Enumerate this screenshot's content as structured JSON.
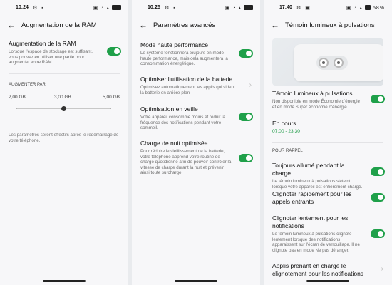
{
  "screen1": {
    "status": {
      "time": "10:24",
      "battery": ""
    },
    "title": "Augmentation de la RAM",
    "ram": {
      "title": "Augmentation de la RAM",
      "desc": "Lorsque l'espace de stockage est suffisant, vous pouvez en utiliser une partie pour augmenter votre RAM.",
      "enabled": true
    },
    "section": "AUGMENTER PAR",
    "slider": {
      "options": [
        "2,00 GB",
        "3,00 GB",
        "5,00 GB"
      ],
      "selected": "3,00 GB"
    },
    "note": "Les paramètres seront effectifs après le redémarrage de votre téléphone."
  },
  "screen2": {
    "status": {
      "time": "10:25"
    },
    "title": "Paramètres avancés",
    "items": [
      {
        "title": "Mode haute performance",
        "desc": "Le système fonctionnera toujours en mode haute performance, mais cela augmentera la consommation énergétique.",
        "control": "toggle",
        "enabled": true
      },
      {
        "title": "Optimiser l'utilisation de la batterie",
        "desc": "Optimisez automatiquement les applis qui vident la batterie en arrière-plan",
        "control": "chevron"
      },
      {
        "title": "Optimisation en veille",
        "desc": "Votre appareil consomme moins et réduit la fréquence des notifications pendant votre sommeil.",
        "control": "toggle",
        "enabled": true
      },
      {
        "title": "Charge de nuit optimisée",
        "desc": "Pour réduire le vieillissement de la batterie, votre téléphone apprend votre routine de charge quotidienne afin de pouvoir contrôler la vitesse de charge durant la nuit et prévenir ainsi toute surcharge.",
        "control": "toggle",
        "enabled": true
      }
    ]
  },
  "screen3": {
    "status": {
      "time": "17:40",
      "battery": "58%"
    },
    "title": "Témoin lumineux à pulsations",
    "main": {
      "title": "Témoin lumineux à pulsations",
      "desc": "Non disponible en mode Économie d'énergie et en mode Super économie d'énergie",
      "enabled": true
    },
    "schedule": {
      "title": "En cours",
      "value": "07:00 - 23:30"
    },
    "section": "POUR RAPPEL",
    "items": [
      {
        "title": "Toujours allumé pendant la charge",
        "desc": "Le témoin lumineux à pulsations s'éteint lorsque votre appareil est entièrement chargé.",
        "control": "toggle",
        "enabled": true
      },
      {
        "title": "Clignoter rapidement pour les appels entrants",
        "desc": "",
        "control": "toggle",
        "enabled": true
      },
      {
        "title": "Clignoter lentement pour les notifications",
        "desc": "Le témoin lumineux à pulsations clignote lentement lorsque des notifications apparaissent sur l'écran de verrouillage. Il ne clignote pas en mode Ne pas déranger.",
        "control": "toggle",
        "enabled": true
      },
      {
        "title": "Applis prenant en charge le clignotement pour les notifications",
        "desc": "",
        "control": "chevron"
      }
    ]
  },
  "icons": {
    "back": "back-arrow-icon",
    "chevron": "chevron-right-icon"
  },
  "colors": {
    "accent": "#1fa04a",
    "schedule_text": "#1d9a45"
  }
}
